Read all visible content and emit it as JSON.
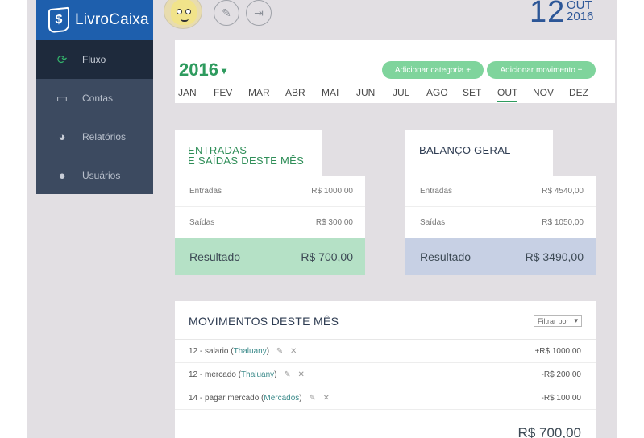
{
  "app": {
    "logo_glyph": "$",
    "logo_text": "LivroCaixa"
  },
  "sidebar": {
    "items": [
      {
        "label": "Fluxo",
        "icon": "refresh-icon",
        "active": true
      },
      {
        "label": "Contas",
        "icon": "card-icon",
        "active": false
      },
      {
        "label": "Relatórios",
        "icon": "pie-chart-icon",
        "active": false
      },
      {
        "label": "Usuários",
        "icon": "user-icon",
        "active": false
      }
    ]
  },
  "topbar": {
    "edit_icon": "pencil-icon",
    "logout_icon": "exit-icon"
  },
  "date": {
    "day": "12",
    "month": "OUT",
    "year": "2016"
  },
  "header": {
    "year": "2016",
    "add_category": "Adicionar categoria +",
    "add_movement": "Adicionar movimento +",
    "months": [
      "JAN",
      "FEV",
      "MAR",
      "ABR",
      "MAI",
      "JUN",
      "JUL",
      "AGO",
      "SET",
      "OUT",
      "NOV",
      "DEZ"
    ],
    "active_month": "OUT"
  },
  "month_card": {
    "title_line1": "ENTRADAS",
    "title_line2": "E SAÍDAS DESTE MÊS",
    "entradas_label": "Entradas",
    "entradas_value": "R$ 1000,00",
    "saidas_label": "Saídas",
    "saidas_value": "R$ 300,00",
    "result_label": "Resultado",
    "result_value": "R$ 700,00"
  },
  "balance_card": {
    "title": "BALANÇO GERAL",
    "entradas_label": "Entradas",
    "entradas_value": "R$ 4540,00",
    "saidas_label": "Saídas",
    "saidas_value": "R$ 1050,00",
    "result_label": "Resultado",
    "result_value": "R$ 3490,00"
  },
  "movements": {
    "title": "MOVIMENTOS DESTE MÊS",
    "filter_label": "Filtrar por",
    "rows": [
      {
        "desc": "12 - salario",
        "tag": "Thaluany",
        "value": "+R$ 1000,00"
      },
      {
        "desc": "12 - mercado",
        "tag": "Thaluany",
        "value": "-R$ 200,00"
      },
      {
        "desc": "14 - pagar mercado",
        "tag": "Mercados",
        "value": "-R$ 100,00"
      }
    ],
    "total": "R$ 700,00"
  },
  "colors": {
    "brand_blue": "#1e5fad",
    "sidebar": "#3c4a60",
    "accent_green": "#2e9b5e",
    "pill_green": "#7fd49c"
  }
}
